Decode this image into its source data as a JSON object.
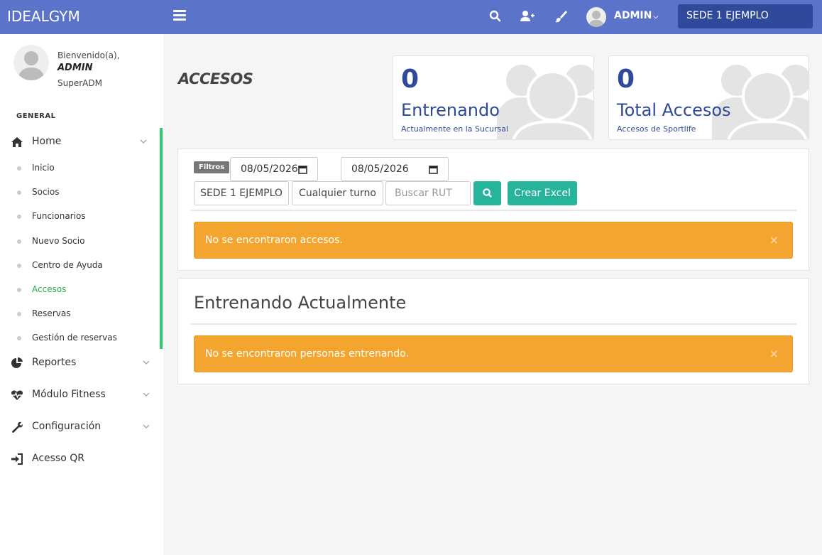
{
  "topbar": {
    "brand": "IDEALGYM",
    "icons": [
      "menu-icon",
      "search-icon",
      "add-user-icon",
      "paint-brush-icon"
    ],
    "user": "ADMIN",
    "sede": "SEDE 1 EJEMPLO",
    "background": "#5b73c9"
  },
  "sidebar": {
    "welcome": "Bienvenido(a),",
    "admin": "ADMIN",
    "role": "SuperADM",
    "section": "GENERAL",
    "home": "Home",
    "home_items": [
      {
        "label": "Inicio"
      },
      {
        "label": "Socios"
      },
      {
        "label": "Funcionarios"
      },
      {
        "label": "Nuevo Socio"
      },
      {
        "label": "Centro de Ayuda"
      },
      {
        "label": "Accesos"
      },
      {
        "label": "Reservas"
      },
      {
        "label": "Gestión de reservas"
      }
    ],
    "reportes": "Reportes",
    "fitness": "Módulo Fitness",
    "config": "Configuración",
    "qr": "Acesso QR",
    "active_color": "#2ecc71"
  },
  "main": {
    "title": "ACCESOS",
    "stats": [
      {
        "number": "0",
        "label": "Entrenando",
        "sub": "Actualmente en la Sucursal"
      },
      {
        "number": "0",
        "label": "Total Accesos",
        "sub": "Accesos de Sportlife"
      }
    ],
    "filters": {
      "badge": "Filtros",
      "date_from": "08/05/2026",
      "date_to": "08/05/2026",
      "sede": "SEDE 1 EJEMPLO",
      "turno": "Cualquier turno",
      "rut_placeholder": "Buscar RUT",
      "excel": "Crear Excel"
    },
    "alert_accesos": "No se encontraron accesos.",
    "section_title": "Entrenando Actualmente",
    "alert_entrenando": "No se encontraron personas entrenando.",
    "close": "×",
    "accent": "#26b59a",
    "warning": "#f3a52f",
    "primary": "#2f4a9a"
  }
}
